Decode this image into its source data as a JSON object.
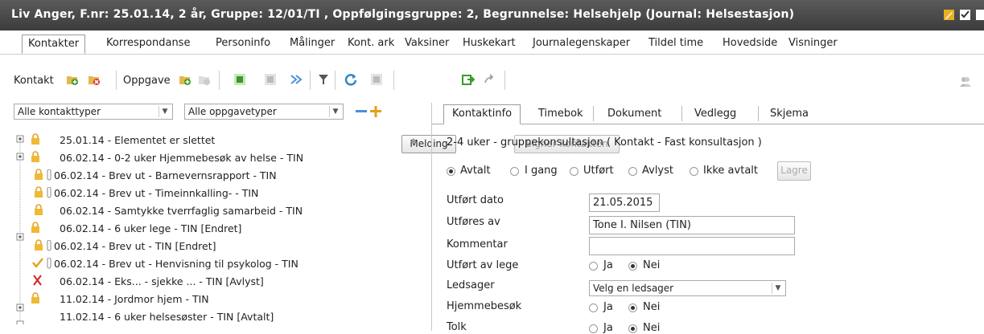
{
  "titlebar": {
    "title": "Liv Anger, F.nr: 25.01.14, 2 år, Gruppe: 12/01/TI , Oppfølgingsgruppe: 2, Begrunnelse: Helsehjelp (Journal: Helsestasjon)"
  },
  "menu": [
    "Kontakter",
    "Korrespondanse",
    "Personinfo",
    "Målinger",
    "Kont. ark",
    "Vaksiner",
    "Huskekart",
    "Journalegenskaper",
    "Tildel time",
    "Hovedside",
    "Visninger"
  ],
  "toolbar": {
    "kontakt_label": "Kontakt",
    "oppgave_label": "Oppgave",
    "melding_label": "Melding",
    "signer_label": "Signer kontakten"
  },
  "filters": {
    "kontakttyper": "Alle kontakttyper",
    "oppgavetyper": "Alle oppgavetyper"
  },
  "tree": [
    "25.01.14 - Elementet er slettet",
    "06.02.14 - 0-2 uker Hjemmebesøk av helse - TIN",
    "06.02.14 - Brev ut - Barnevernsrapport - TIN",
    "06.02.14 - Brev ut - Timeinnkalling- - TIN",
    "06.02.14 - Samtykke tverrfaglig samarbeid - TIN",
    "06.02.14 - 6 uker lege - TIN [Endret]",
    "06.02.14 - Brev ut - TIN [Endret]",
    "06.02.14 - Brev ut - Henvisning til psykolog - TIN",
    "06.02.14 - Eks... - sjekke ... - TIN [Avlyst]",
    "11.02.14 - Jordmor hjem - TIN",
    "11.02.14 - 6 uker helsesøster - TIN [Avtalt]"
  ],
  "right": {
    "tabs": [
      "Kontaktinfo",
      "Timebok",
      "Dokument",
      "Vedlegg",
      "Skjema"
    ],
    "heading": "2-4 uker - gruppekonsultasjon ( Kontakt - Fast konsultasjon )",
    "status_options": [
      "Avtalt",
      "I gang",
      "Utført",
      "Avlyst",
      "Ikke avtalt"
    ],
    "lagre": "Lagre",
    "labels": {
      "utfort_dato": "Utført dato",
      "utfores_av": "Utføres av",
      "kommentar": "Kommentar",
      "utfort_av_lege": "Utført av lege",
      "ledsager": "Ledsager",
      "hjemmebesok": "Hjemmebesøk",
      "tolk": "Tolk"
    },
    "values": {
      "utfort_dato": "21.05.2015",
      "utfores_av": "Tone I. Nilsen (TIN)",
      "kommentar": "",
      "ledsager": "Velg en ledsager"
    },
    "ja": "Ja",
    "nei": "Nei"
  }
}
